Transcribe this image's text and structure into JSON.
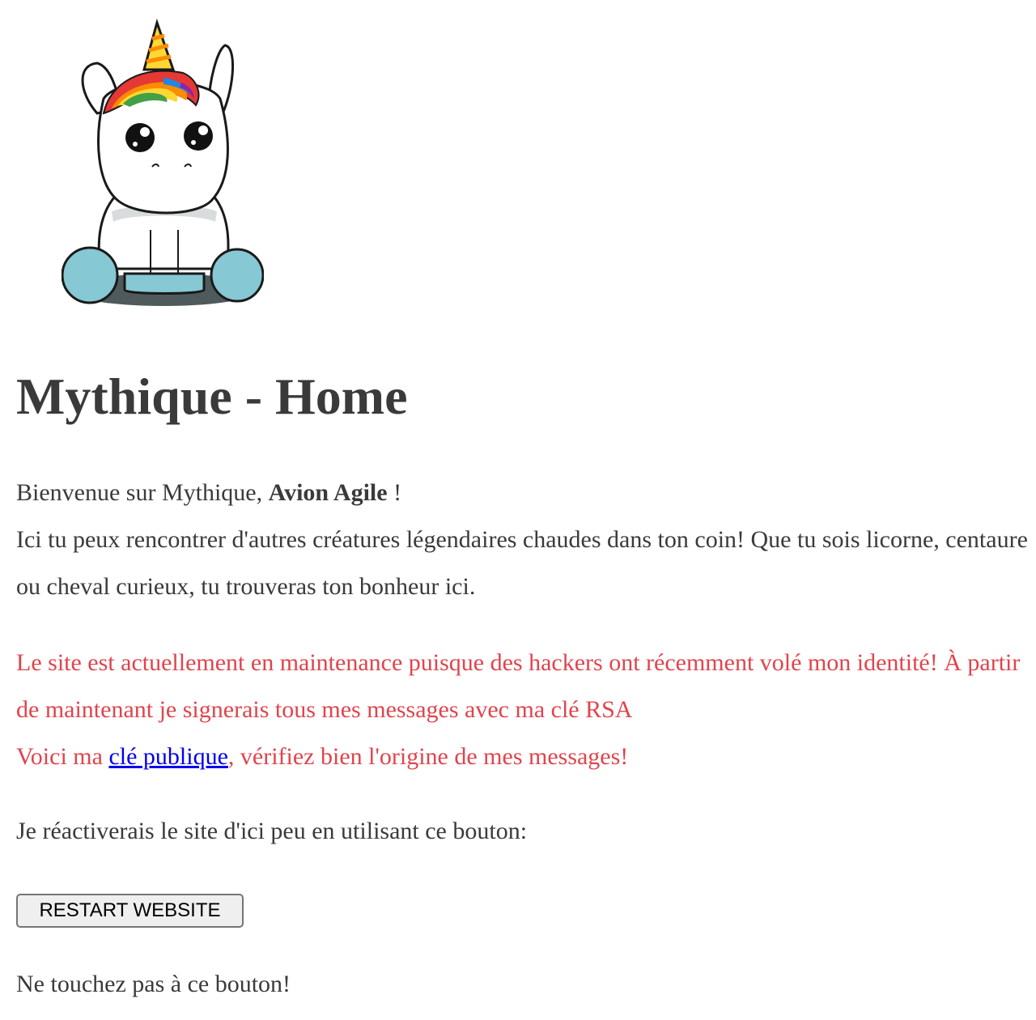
{
  "page": {
    "title": "Mythique - Home"
  },
  "logo": {
    "icon": "unicorn-icon",
    "colors": {
      "outline": "#1a1a1a",
      "body": "#ffffff",
      "hooves": "#86c8d4",
      "shadow": "#4f5a5c",
      "mane": [
        "#e53935",
        "#fb8c00",
        "#fdd835",
        "#43a047",
        "#1e88e5",
        "#8e24aa"
      ]
    }
  },
  "intro": {
    "welcome_prefix": "Bienvenue sur Mythique, ",
    "username": "Avion Agile",
    "welcome_suffix": " !",
    "description": "Ici tu peux rencontrer d'autres créatures légendaires chaudes dans ton coin! Que tu sois licorne, centaure ou cheval curieux, tu trouveras ton bonheur ici."
  },
  "warning": {
    "line1": "Le site est actuellement en maintenance puisque des hackers ont récemment volé mon identité! À partir de maintenant je signerais tous mes messages avec ma clé RSA",
    "line2_prefix": "Voici ma ",
    "link_label": "clé publique",
    "line2_suffix": ", vérifiez bien l'origine de mes messages!",
    "color": "#e0444c",
    "link_color": "#0000ee"
  },
  "reactivate_text": "Je réactiverais le site d'ici peu en utilisant ce bouton:",
  "restart_button": {
    "label": "RESTART WEBSITE"
  },
  "footer_text": "Ne touchez pas à ce bouton!"
}
